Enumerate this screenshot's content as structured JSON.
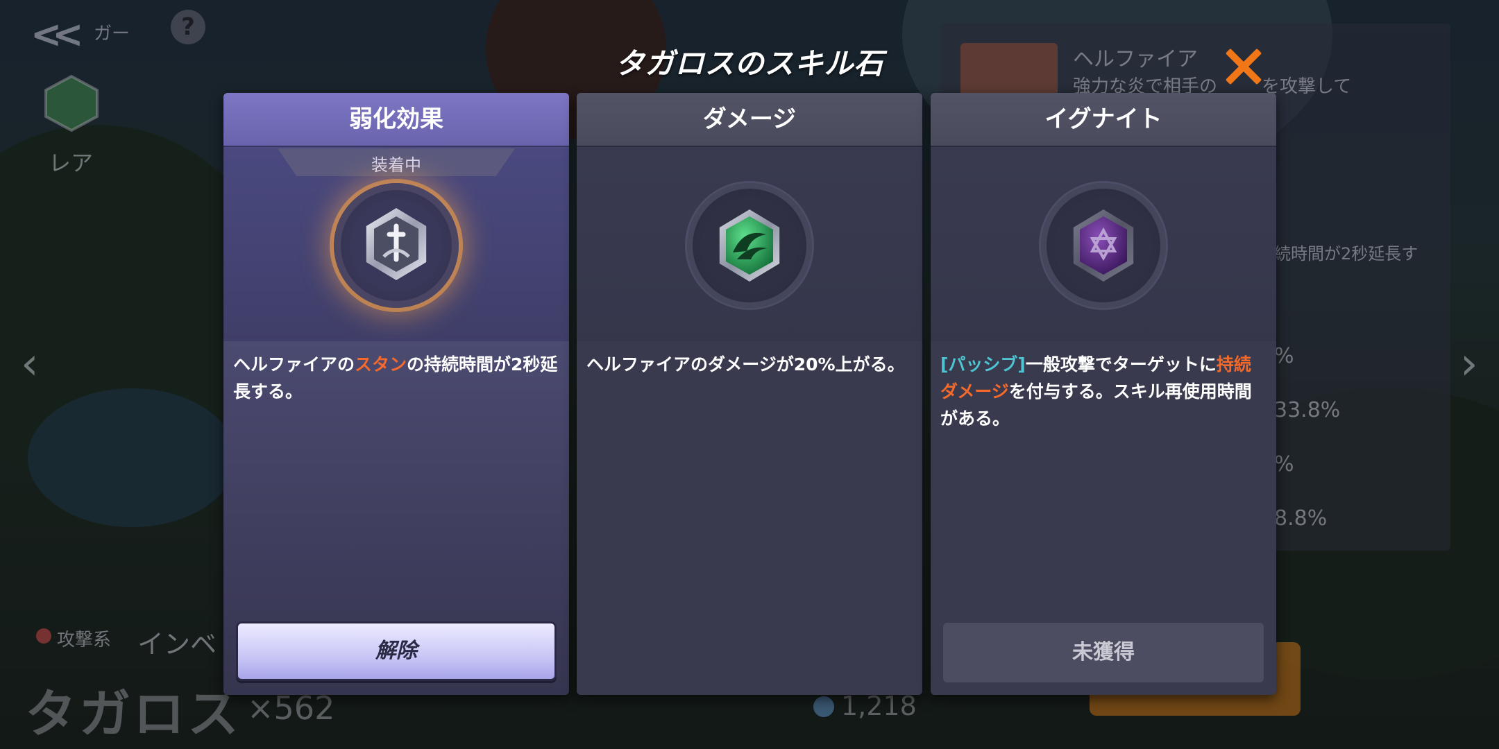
{
  "background": {
    "crumb_label": "ガー",
    "help_label": "?",
    "back_label": "<<",
    "rarity_label": "レア",
    "nav_prev": "‹",
    "nav_next": "›",
    "category_label": "攻撃系",
    "inventory_label": "インベ",
    "hero_name": "タガロス",
    "hero_count": "×562",
    "coin_value": "1,218",
    "info_panel": {
      "skill_name": "ヘルファイア",
      "skill_desc": "強力な炎で相手の",
      "skill_desc_tail": "を攻撃して",
      "effect_line": "続時間が2秒延長す",
      "stats": [
        "%",
        "33.8%",
        "%",
        "8.8%"
      ]
    }
  },
  "dialog": {
    "title": "タガロスのスキル石",
    "close_icon": "close-icon",
    "cards": [
      {
        "name": "弱化効果",
        "status": "装着中",
        "gem_icon": "dagger-gem-icon",
        "gem_color": "#c9ccd8",
        "desc_parts": [
          "ヘルファイアの",
          "スタン",
          "の持続時間が2秒延長する。"
        ],
        "button_label": "解除"
      },
      {
        "name": "ダメージ",
        "gem_icon": "claw-gem-icon",
        "gem_color": "#2fae5c",
        "desc_parts": [
          "ヘルファイアのダメージが20%上がる。"
        ]
      },
      {
        "name": "イグナイト",
        "gem_icon": "hexagram-gem-icon",
        "gem_color": "#6a2f9a",
        "desc_parts": [
          "[パッシブ]",
          "一般攻撃でターゲットに",
          "持続ダメージ",
          "を付与する。スキル再使用時間がある。"
        ],
        "button_label": "未獲得"
      }
    ]
  },
  "colors": {
    "accent_orange": "#f07618",
    "highlight_orange": "#f46a2c",
    "highlight_cyan": "#4ec4d2",
    "active_header": "#7d76c4"
  }
}
